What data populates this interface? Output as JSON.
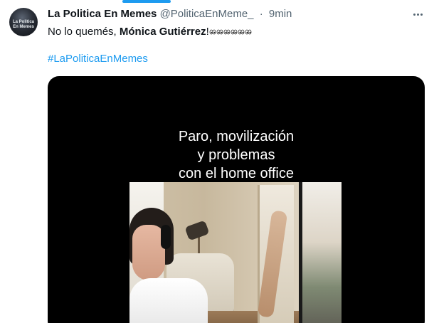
{
  "tweet": {
    "display_name": "La Politica En Memes",
    "handle": "@PoliticaEnMeme_",
    "separator": "·",
    "time": "9min",
    "text_prefix": "No lo quemés, ",
    "text_bold": "Mónica Gutiérrez",
    "text_suffix": "!",
    "emoji_icon": "eyes-icon",
    "emoji_count": 6,
    "hashtag": "#LaPoliticaEnMemes"
  },
  "avatar": {
    "line1": "La Politica",
    "line2": "En Memes"
  },
  "media": {
    "caption_line1": "Paro, movilización",
    "caption_line2": "y problemas",
    "caption_line3": "con el home office"
  },
  "colors": {
    "accent": "#1d9bf0",
    "text_primary": "#0f1419",
    "text_secondary": "#536471",
    "media_background": "#000000"
  },
  "icons": {
    "more": "more-horizontal-icon"
  }
}
